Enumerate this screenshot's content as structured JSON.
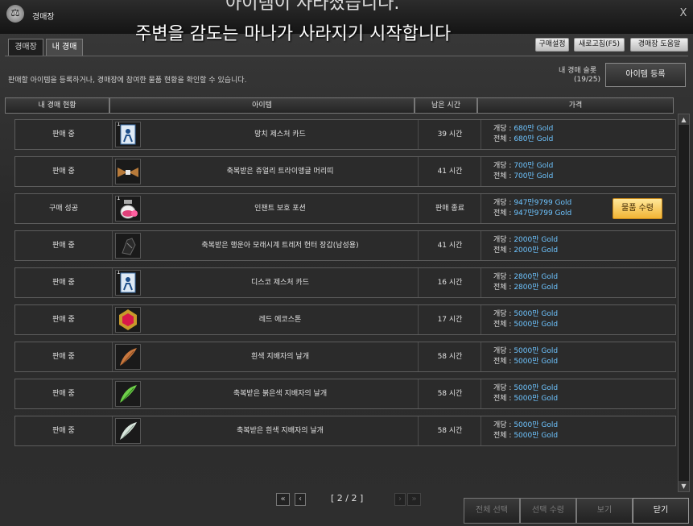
{
  "window": {
    "title": "경매장",
    "overlay_top": "아이템이 사라졌습니다.",
    "overlay_main": "주변을 감도는 마나가 사라지기 시작합니다",
    "close": "X"
  },
  "top_buttons": [
    "구매설정",
    "새로고침(F5)",
    "경매장 도움말"
  ],
  "tabs": [
    {
      "label": "경매장",
      "active": false
    },
    {
      "label": "내 경매",
      "active": true
    }
  ],
  "description": "판매할 아이템을 등록하거나, 경매장에 참여한 물품 현황을 확인할 수 있습니다.",
  "slots": {
    "label": "내 경매 슬롯",
    "count": "(19/25)"
  },
  "register_button": "아이템 등록",
  "headers": [
    "내 경매 현황",
    "아이템",
    "남은 시간",
    "가격"
  ],
  "rows": [
    {
      "status": "판매 중",
      "qty": "1",
      "icon": "card-icon",
      "name": "망치 제스처 카드",
      "time": "39 시간",
      "unit_label": "개당 : ",
      "unit": "680만 Gold",
      "total_label": "전체 : ",
      "total": "680만 Gold"
    },
    {
      "status": "판매 중",
      "qty": "",
      "icon": "triangle-hair-icon",
      "name": "축복받은 쥬얼리 트라이앵글 머리띠",
      "time": "41 시간",
      "unit_label": "개당 : ",
      "unit": "700만 Gold",
      "total_label": "전체 : ",
      "total": "700만 Gold"
    },
    {
      "status": "구매 성공",
      "qty": "1",
      "icon": "potion-icon",
      "name": "인챈트 보호 포션",
      "time": "판매 종료",
      "unit_label": "개당 : ",
      "unit": "947만9799 Gold",
      "total_label": "전체 : ",
      "total": "947만9799 Gold",
      "claim": "물품 수령"
    },
    {
      "status": "판매 중",
      "qty": "",
      "icon": "gauntlet-icon",
      "name": "축복받은 행운아 모래시계 트레저 헌터 장갑(남성용)",
      "time": "41 시간",
      "unit_label": "개당 : ",
      "unit": "2000만 Gold",
      "total_label": "전체 : ",
      "total": "2000만 Gold"
    },
    {
      "status": "판매 중",
      "qty": "1",
      "icon": "card-icon",
      "name": "디스코 제스처 카드",
      "time": "16 시간",
      "unit_label": "개당 : ",
      "unit": "2800만 Gold",
      "total_label": "전체 : ",
      "total": "2800만 Gold"
    },
    {
      "status": "판매 중",
      "qty": "",
      "icon": "red-gem-icon",
      "name": "레드 에코스톤",
      "time": "17 시간",
      "unit_label": "개당 : ",
      "unit": "5000만 Gold",
      "total_label": "전체 : ",
      "total": "5000만 Gold"
    },
    {
      "status": "판매 중",
      "qty": "",
      "icon": "brown-wing-icon",
      "name": "흰색 지배자의 날개",
      "time": "58 시간",
      "unit_label": "개당 : ",
      "unit": "5000만 Gold",
      "total_label": "전체 : ",
      "total": "5000만 Gold"
    },
    {
      "status": "판매 중",
      "qty": "",
      "icon": "green-wing-icon",
      "name": "축복받은 붉은색 지배자의 날개",
      "time": "58 시간",
      "unit_label": "개당 : ",
      "unit": "5000만 Gold",
      "total_label": "전체 : ",
      "total": "5000만 Gold"
    },
    {
      "status": "판매 중",
      "qty": "",
      "icon": "white-wing-icon",
      "name": "축복받은 흰색 지배자의 날개",
      "time": "58 시간",
      "unit_label": "개당 : ",
      "unit": "5000만 Gold",
      "total_label": "전체 : ",
      "total": "5000만 Gold"
    }
  ],
  "pagination": {
    "first": "«",
    "prev": "‹",
    "text": "[ 2 / 2 ]",
    "next": "›",
    "last": "»"
  },
  "bottom_buttons": [
    "전체 선택",
    "선택 수령",
    "보기",
    "닫기"
  ],
  "colors": {
    "gold": "#6ec4ff",
    "claim": "#f2b535"
  }
}
